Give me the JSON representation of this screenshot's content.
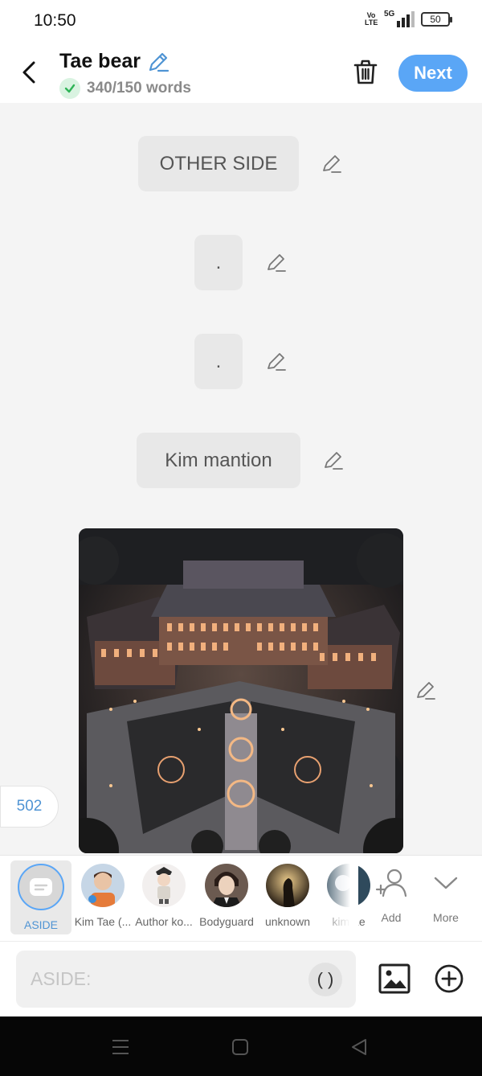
{
  "status": {
    "time": "10:50",
    "network": "5G",
    "volte": "Vo LTE",
    "battery": "50"
  },
  "header": {
    "title": "Tae bear",
    "word_count": "340/150 words",
    "next_label": "Next"
  },
  "messages": [
    {
      "text": "OTHER SIDE"
    },
    {
      "text": "."
    },
    {
      "text": "."
    },
    {
      "text": "Kim mantion"
    }
  ],
  "counter": "502",
  "characters": {
    "aside_label": "ASIDE",
    "items": [
      {
        "name": "Kim Tae (...",
        "avatar_color": "#c6d6e6"
      },
      {
        "name": "Author ko...",
        "avatar_color": "#f2efee"
      },
      {
        "name": "Bodyguard",
        "avatar_color": "#4a3a33"
      },
      {
        "name": "unknown",
        "avatar_color": "#5c4a2c"
      },
      {
        "name": "kim Le",
        "avatar_color": "#2f4a5c"
      }
    ],
    "add_label": "Add",
    "more_label": "More"
  },
  "input": {
    "placeholder": "ASIDE:",
    "paren_label": "( )"
  },
  "colors": {
    "accent": "#5aa6f6",
    "check_green": "#2fb457"
  }
}
